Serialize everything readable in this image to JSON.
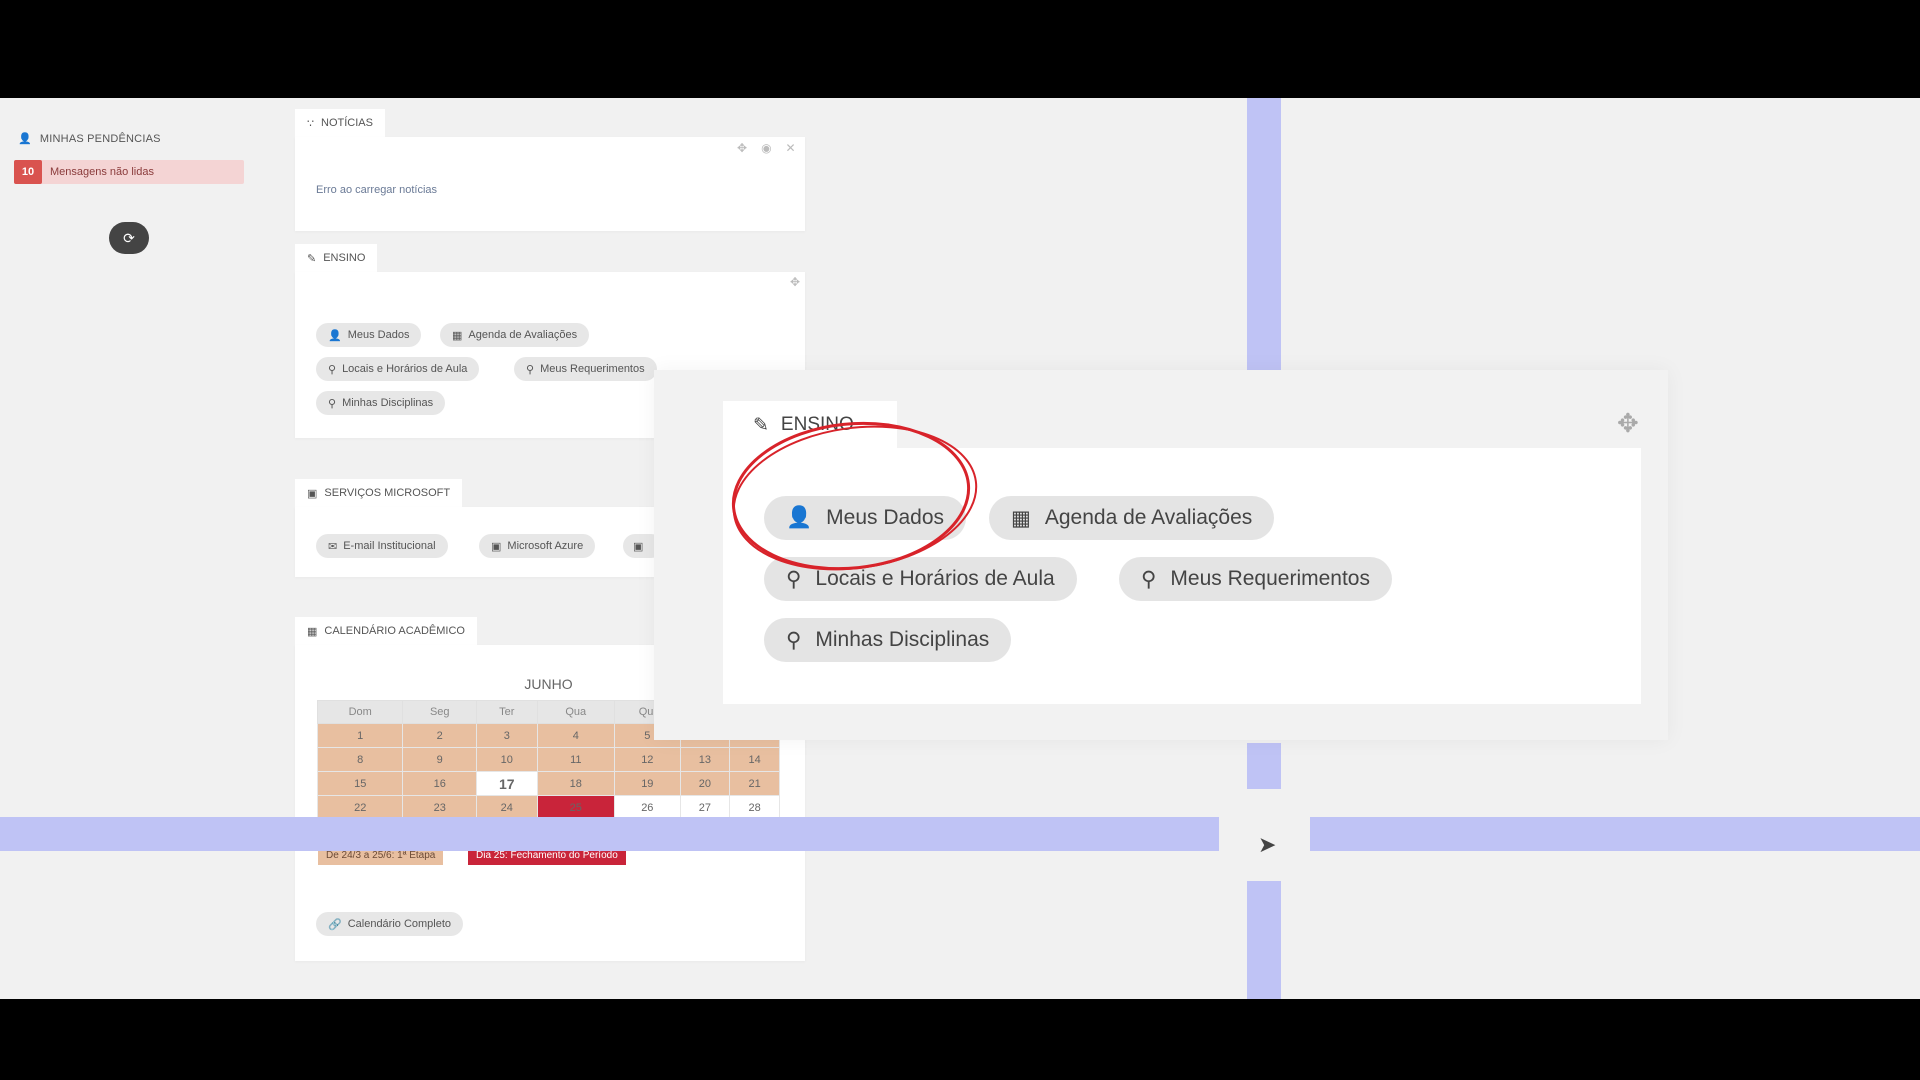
{
  "pendencias": {
    "title": "MINHAS PENDÊNCIAS",
    "count": "10",
    "label": "Mensagens não lidas"
  },
  "noticias": {
    "title": "NOTÍCIAS",
    "error": "Erro ao carregar notícias"
  },
  "ensino": {
    "title": "ENSINO",
    "buttons": [
      "Meus Dados",
      "Agenda de Avaliações",
      "Locais e Horários de Aula",
      "Meus Requerimentos",
      "Minhas Disciplinas"
    ]
  },
  "microsoft": {
    "title": "SERVIÇOS MICROSOFT",
    "buttons": [
      "E-mail Institucional",
      "Microsoft Azure"
    ]
  },
  "calendario": {
    "title": "CALENDÁRIO ACADÊMICO",
    "month": "JUNHO",
    "weekdays": [
      "Dom",
      "Seg",
      "Ter",
      "Qua",
      "Qui"
    ],
    "legend_etapa": "De 24/3 a 25/6: 1ª Etapa",
    "legend_fechamento": "Dia 25: Fechamento do Período",
    "full_link": "Calendário Completo"
  },
  "zoom": {
    "title": "ENSINO",
    "buttons": [
      "Meus Dados",
      "Agenda de Avaliações",
      "Locais e Horários de Aula",
      "Meus Requerimentos",
      "Minhas Disciplinas"
    ]
  },
  "colors": {
    "accent_red": "#c9243a",
    "period_peach": "#e8bfa0",
    "guide_blue": "#bfc3f5",
    "annotation_red": "#d8232a"
  }
}
